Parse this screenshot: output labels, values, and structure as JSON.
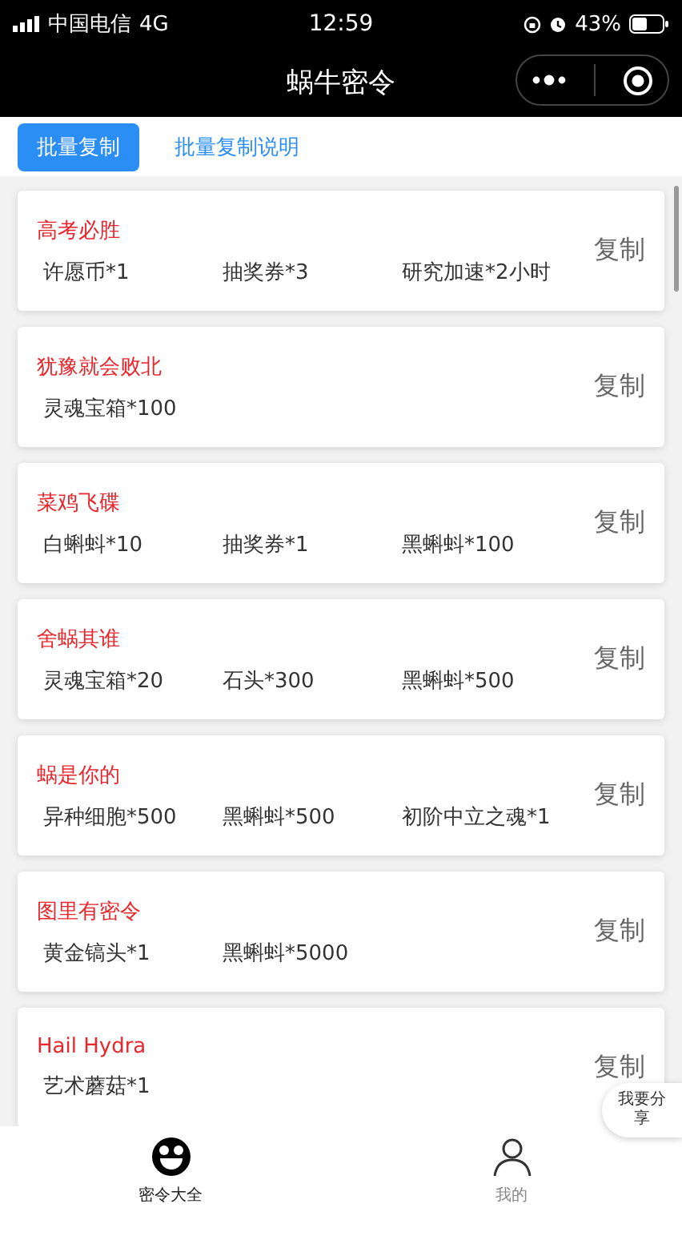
{
  "status_bar": {
    "carrier": "中国电信",
    "network": "4G",
    "time": "12:59",
    "battery": "43%"
  },
  "nav_bar": {
    "title": "蜗牛密令"
  },
  "actions": [
    {
      "label": "批量复制",
      "kind": "primary"
    },
    {
      "label": "批量复制说明",
      "kind": "link"
    }
  ],
  "codes": [
    {
      "title": "高考必胜",
      "rewards": [
        "许愿币*1",
        "抽奖券*3",
        "研究加速*2小时"
      ],
      "copy": "复制"
    },
    {
      "title": "犹豫就会败北",
      "rewards": [
        "灵魂宝箱*100"
      ],
      "copy": "复制"
    },
    {
      "title": "菜鸡飞碟",
      "rewards": [
        "白蝌蚪*10",
        "抽奖券*1",
        "黑蝌蚪*100"
      ],
      "copy": "复制"
    },
    {
      "title": "舍蜗其谁",
      "rewards": [
        "灵魂宝箱*20",
        "石头*300",
        "黑蝌蚪*500"
      ],
      "copy": "复制"
    },
    {
      "title": "蜗是你的",
      "rewards": [
        "异种细胞*500",
        "黑蝌蚪*500",
        "初阶中立之魂*1"
      ],
      "copy": "复制"
    },
    {
      "title": "图里有密令",
      "rewards": [
        "黄金镐头*1",
        "黑蝌蚪*5000"
      ],
      "copy": "复制"
    },
    {
      "title": "Hail Hydra",
      "rewards": [
        "艺术蘑菇*1"
      ],
      "copy": "复制"
    }
  ],
  "share_button": {
    "label": "我要分享"
  },
  "tab_bar": [
    {
      "label": "密令大全",
      "selected": true
    },
    {
      "label": "我的",
      "selected": false
    }
  ]
}
